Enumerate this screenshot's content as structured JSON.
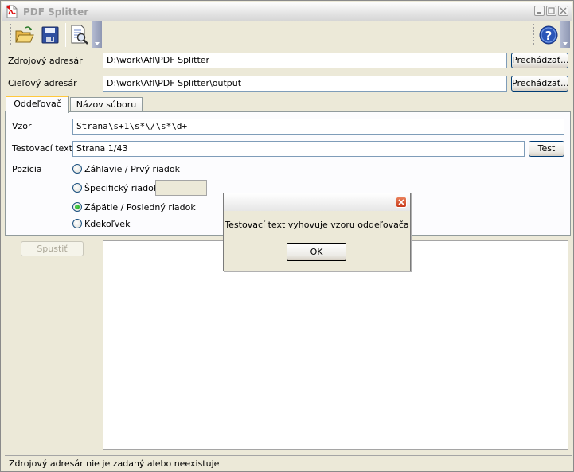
{
  "window": {
    "title": "PDF Splitter",
    "icon": "pdf-document-icon"
  },
  "toolbar": {
    "buttons": [
      {
        "name": "open",
        "icon": "folder-open-icon"
      },
      {
        "name": "save",
        "icon": "floppy-disk-icon"
      },
      {
        "name": "preview",
        "icon": "document-magnify-icon"
      },
      {
        "name": "help",
        "icon": "help-icon"
      }
    ]
  },
  "paths": {
    "source_label": "Zdrojový adresár",
    "source_value": "D:\\work\\AfI\\PDF Splitter",
    "target_label": "Cieľový adresár",
    "target_value": "D:\\work\\AfI\\PDF Splitter\\output",
    "browse_label": "Prechádzať..."
  },
  "tabs": [
    {
      "label": "Oddeľovač",
      "active": true
    },
    {
      "label": "Názov súboru",
      "active": false
    }
  ],
  "separator": {
    "pattern_label": "Vzor",
    "pattern_value": "Strana\\s+1\\s*\\/\\s*\\d+",
    "test_text_label": "Testovací text",
    "test_text_value": "Strana 1/43",
    "test_button": "Test",
    "position_label": "Pozícia",
    "positions": [
      {
        "label": "Záhlavie / Prvý riadok",
        "checked": false
      },
      {
        "label": "Špecifický riadok",
        "checked": false
      },
      {
        "label": "Zápätie / Posledný riadok",
        "checked": true
      },
      {
        "label": "Kdekoľvek",
        "checked": false
      }
    ],
    "specific_line_value": ""
  },
  "actions": {
    "run_label": "Spustiť"
  },
  "status": {
    "text": "Zdrojový adresár nie je zadaný alebo neexistuje"
  },
  "dialog": {
    "message": "Testovací text vyhovuje vzoru oddeľovača",
    "ok_label": "OK"
  },
  "colors": {
    "accent_tab": "#ffc83c",
    "button_border": "#003c74",
    "close_red": "#c8391a"
  }
}
